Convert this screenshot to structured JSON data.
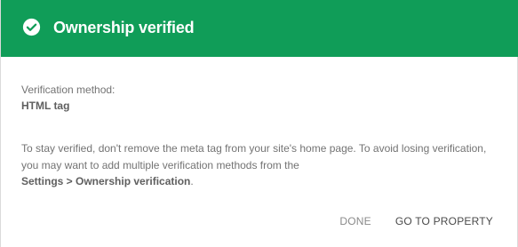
{
  "header": {
    "title": "Ownership verified",
    "icon": "check-circle-icon",
    "background": "#109d58"
  },
  "verification": {
    "method_label": "Verification method:",
    "method_value": "HTML tag"
  },
  "info": {
    "text_before": "To stay verified, don't remove the meta tag from your site's home page. To avoid losing verification, you may want to add multiple verification methods from the",
    "settings_path": "Settings > Ownership verification",
    "text_after": "."
  },
  "actions": {
    "done_label": "DONE",
    "go_label": "GO TO PROPERTY"
  }
}
